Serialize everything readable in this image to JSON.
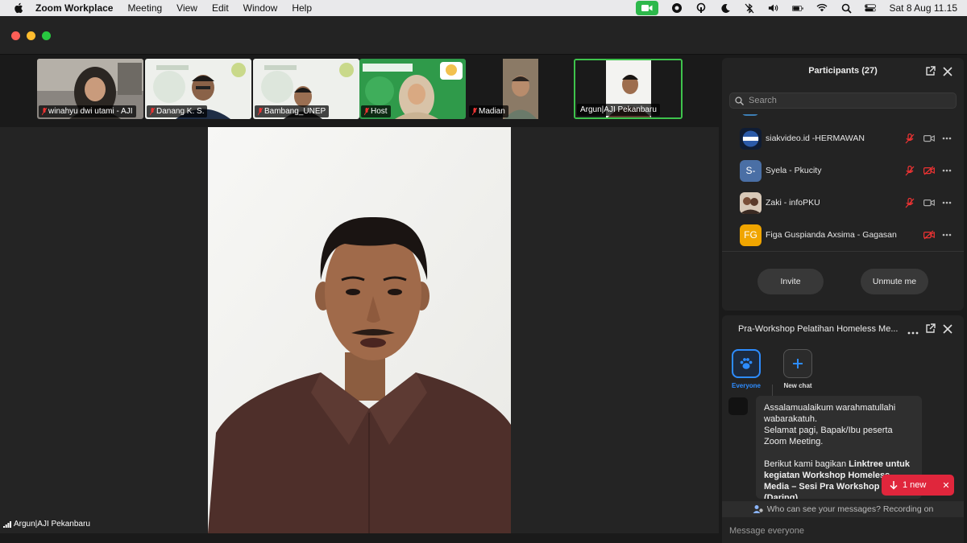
{
  "menubar": {
    "app_name": "Zoom Workplace",
    "items": [
      "Meeting",
      "View",
      "Edit",
      "Window",
      "Help"
    ],
    "clock": "Sat 8 Aug  11.15",
    "status_icons": [
      "zoom-camera-icon",
      "focus-icon",
      "hotspot-icon",
      "moon-icon",
      "bluetooth-off-icon",
      "volume-icon",
      "battery-icon",
      "wifi-icon",
      "search-icon",
      "control-center-icon"
    ]
  },
  "gallery": {
    "tiles": [
      {
        "name": "winahyu dwi utami - AJI",
        "muted": true
      },
      {
        "name": "Danang K. S.",
        "muted": true
      },
      {
        "name": "Bambang_UNEP",
        "muted": true
      },
      {
        "name": "Host",
        "muted": true
      },
      {
        "name": "Madian",
        "muted": true
      },
      {
        "name": "Argun|AJI Pekanbaru",
        "muted": false,
        "active": true
      }
    ]
  },
  "stage": {
    "speaker_name": "Argun|AJI Pekanbaru"
  },
  "participants": {
    "title": "Participants (27)",
    "search_placeholder": "Search",
    "list": [
      {
        "name": "siakvideo.id -HERMAWAN",
        "initials": "",
        "avatar_color": "#1b2b4a",
        "mic_muted": true,
        "video_off": false
      },
      {
        "name": "Syela - Pkucity",
        "initials": "S-",
        "avatar_color": "#4a6fa5",
        "mic_muted": true,
        "video_off": true
      },
      {
        "name": "Zaki - infoPKU",
        "initials": "",
        "avatar_color": "#6b4a3a",
        "mic_muted": true,
        "video_off": false
      },
      {
        "name": "Figa Guspianda Axsima - Gagasan",
        "initials": "FG",
        "avatar_color": "#f0a500",
        "mic_muted": false,
        "video_off": true
      }
    ],
    "invite_label": "Invite",
    "unmute_label": "Unmute me"
  },
  "chat": {
    "title": "Pra-Workshop Pelatihan Homeless Me...",
    "tabs": [
      {
        "label": "Everyone"
      },
      {
        "label": "New chat"
      }
    ],
    "message": {
      "line1": "Assalamualaikum warahmatullahi wabarakatuh.",
      "line2": "Selamat pagi, Bapak/Ibu peserta Zoom Meeting.",
      "line3_intro": "Berikut kami bagikan ",
      "line3_bold": "Linktree untuk kegiatan Workshop Homeless Media – Sesi Pra Workshop (Daring)"
    },
    "new_badge": "1 new",
    "who_can_see": "Who can see your messages? Recording on",
    "input_placeholder": "Message everyone"
  }
}
